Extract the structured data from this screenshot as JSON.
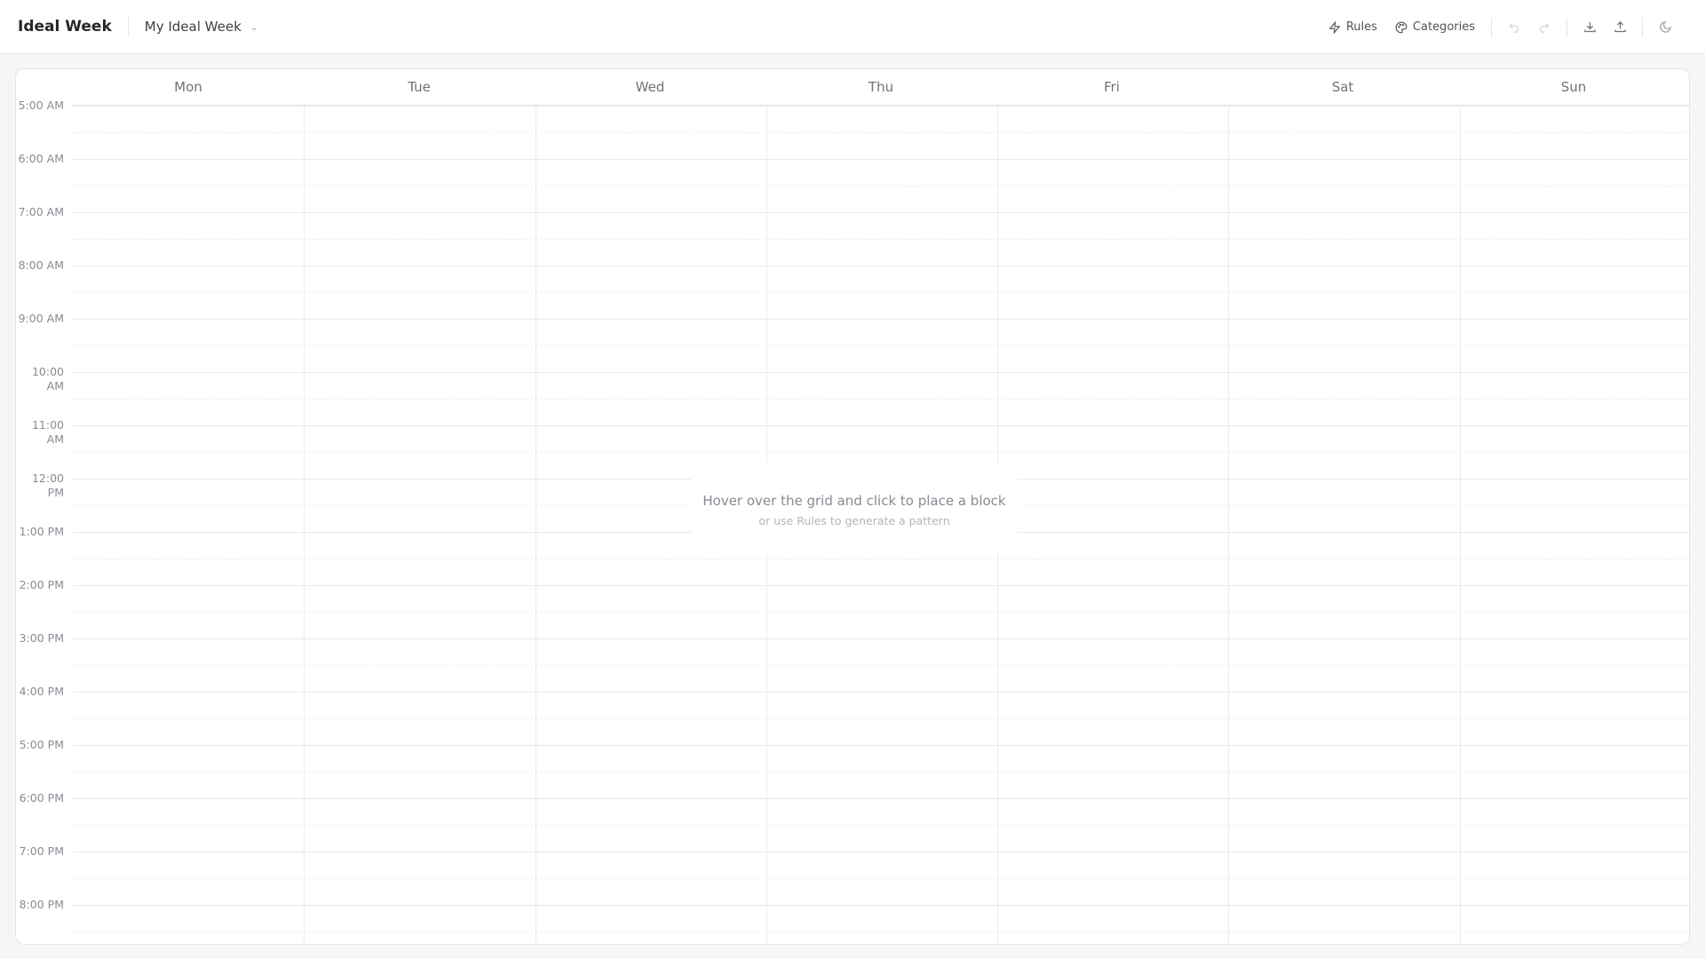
{
  "header": {
    "brand": "Ideal Week",
    "week_selector": "My Ideal Week",
    "rules_label": "Rules",
    "categories_label": "Categories"
  },
  "days": [
    "Mon",
    "Tue",
    "Wed",
    "Thu",
    "Fri",
    "Sat",
    "Sun"
  ],
  "hours": [
    "5:00 AM",
    "6:00 AM",
    "7:00 AM",
    "8:00 AM",
    "9:00 AM",
    "10:00 AM",
    "11:00 AM",
    "12:00 PM",
    "1:00 PM",
    "2:00 PM",
    "3:00 PM",
    "4:00 PM",
    "5:00 PM",
    "6:00 PM",
    "7:00 PM",
    "8:00 PM"
  ],
  "empty_state": {
    "title": "Hover over the grid and click to place a block",
    "subtitle": "or use Rules to generate a pattern"
  }
}
